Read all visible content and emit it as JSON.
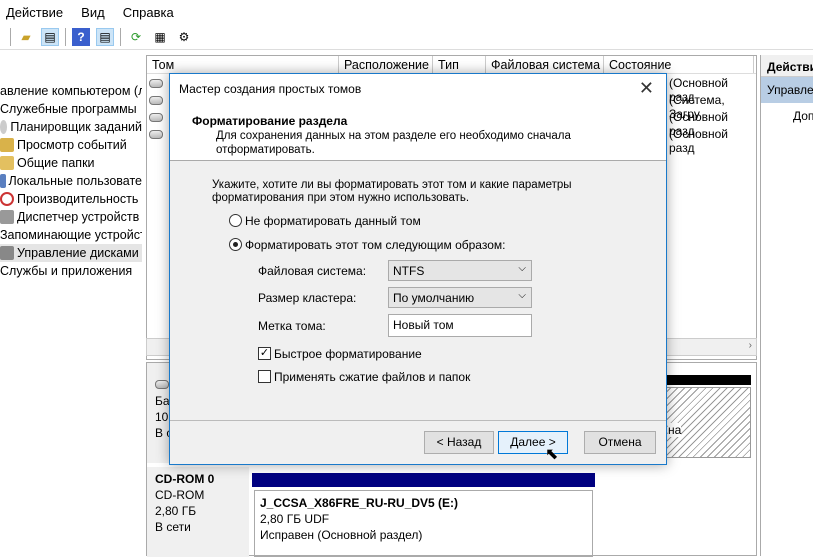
{
  "menu": [
    "Действие",
    "Вид",
    "Справка"
  ],
  "tree": {
    "items": [
      {
        "label": "авление компьютером (л",
        "icon": "computer-icon"
      },
      {
        "label": "Служебные программы",
        "icon": "tools-icon"
      },
      {
        "label": "Планировщик заданий",
        "icon": "clock-icon"
      },
      {
        "label": "Просмотр событий",
        "icon": "event-viewer-icon"
      },
      {
        "label": "Общие папки",
        "icon": "shared-folder-icon"
      },
      {
        "label": "Локальные пользовате",
        "icon": "users-icon"
      },
      {
        "label": "Производительность",
        "icon": "performance-icon"
      },
      {
        "label": "Диспетчер устройств",
        "icon": "device-manager-icon"
      },
      {
        "label": "Запоминающие устройст",
        "icon": "storage-icon"
      },
      {
        "label": "Управление дисками",
        "icon": "disk-management-icon",
        "selected": true
      },
      {
        "label": "Службы и приложения",
        "icon": "services-icon"
      }
    ]
  },
  "list": {
    "columns": [
      "Том",
      "Расположение",
      "Тип",
      "Файловая система",
      "Состояние"
    ],
    "rows_state": [
      "(Основной разд",
      "(Система, Загру",
      "(Основной разд",
      "(Основной разд"
    ]
  },
  "actions": {
    "header": "Действи",
    "selected": "Управле",
    "sub": "Доп"
  },
  "disks": {
    "disk0": {
      "l1": "Ба",
      "l2": "10",
      "l3": "В с"
    },
    "disk0_right_label": "на",
    "cdrom": {
      "name": "CD-ROM 0",
      "type": "CD-ROM",
      "size": "2,80 ГБ",
      "status": "В сети",
      "partition": {
        "name": "J_CCSA_X86FRE_RU-RU_DV5  (E:)",
        "size": "2,80 ГБ UDF",
        "state": "Исправен (Основной раздел)"
      }
    },
    "partition_bar_color": "#000080"
  },
  "dialog": {
    "title": "Мастер создания простых томов",
    "heading": "Форматирование раздела",
    "subheading": "Для сохранения данных на этом разделе его необходимо сначала отформатировать.",
    "instruction": "Укажите, хотите ли вы форматировать этот том и какие параметры форматирования при этом нужно использовать.",
    "radio_no": "Не форматировать данный том",
    "radio_yes": "Форматировать этот том следующим образом:",
    "fs_label": "Файловая система:",
    "fs_value": "NTFS",
    "cluster_label": "Размер кластера:",
    "cluster_value": "По умолчанию",
    "volume_label": "Метка тома:",
    "volume_value": "Новый том",
    "quick_format": "Быстрое форматирование",
    "quick_format_checked": true,
    "compression": "Применять сжатие файлов и папок",
    "compression_checked": false,
    "back": "< Назад",
    "next": "Далее >",
    "cancel": "Отмена"
  }
}
